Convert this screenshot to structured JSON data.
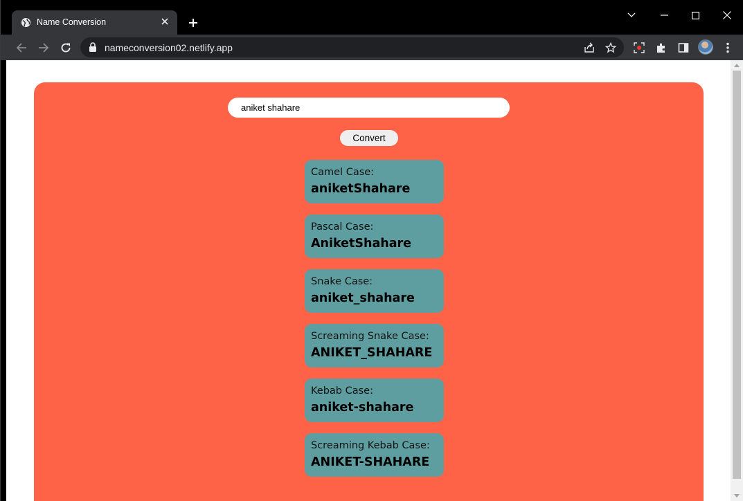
{
  "browser": {
    "tab_title": "Name Conversion",
    "url": "nameconversion02.netlify.app"
  },
  "app": {
    "input_value": "aniket shahare",
    "convert_label": "Convert",
    "results": [
      {
        "label": "Camel Case:",
        "value": "aniketShahare"
      },
      {
        "label": "Pascal Case:",
        "value": "AniketShahare"
      },
      {
        "label": "Snake Case:",
        "value": "aniket_shahare"
      },
      {
        "label": "Screaming Snake Case:",
        "value": "ANIKET_SHAHARE"
      },
      {
        "label": "Kebab Case:",
        "value": "aniket-shahare"
      },
      {
        "label": "Screaming Kebab Case:",
        "value": "ANIKET-SHAHARE"
      }
    ]
  },
  "colors": {
    "card_background": "#ff6347",
    "result_background": "#5f9ea0"
  }
}
